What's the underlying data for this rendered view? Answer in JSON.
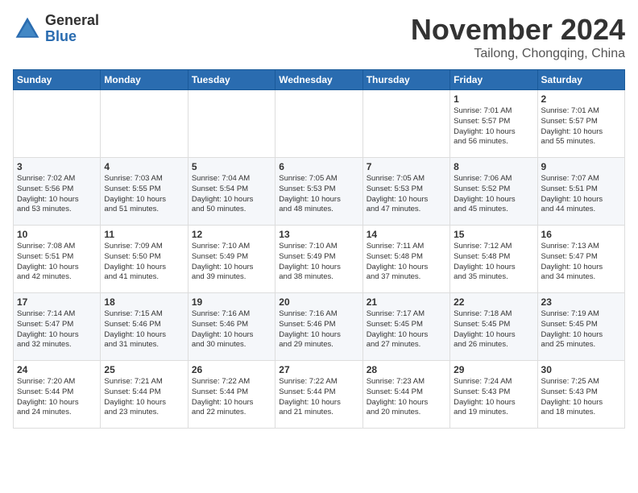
{
  "header": {
    "logo_general": "General",
    "logo_blue": "Blue",
    "title": "November 2024",
    "location": "Tailong, Chongqing, China"
  },
  "weekdays": [
    "Sunday",
    "Monday",
    "Tuesday",
    "Wednesday",
    "Thursday",
    "Friday",
    "Saturday"
  ],
  "weeks": [
    [
      {
        "day": "",
        "info": ""
      },
      {
        "day": "",
        "info": ""
      },
      {
        "day": "",
        "info": ""
      },
      {
        "day": "",
        "info": ""
      },
      {
        "day": "",
        "info": ""
      },
      {
        "day": "1",
        "info": "Sunrise: 7:01 AM\nSunset: 5:57 PM\nDaylight: 10 hours\nand 56 minutes."
      },
      {
        "day": "2",
        "info": "Sunrise: 7:01 AM\nSunset: 5:57 PM\nDaylight: 10 hours\nand 55 minutes."
      }
    ],
    [
      {
        "day": "3",
        "info": "Sunrise: 7:02 AM\nSunset: 5:56 PM\nDaylight: 10 hours\nand 53 minutes."
      },
      {
        "day": "4",
        "info": "Sunrise: 7:03 AM\nSunset: 5:55 PM\nDaylight: 10 hours\nand 51 minutes."
      },
      {
        "day": "5",
        "info": "Sunrise: 7:04 AM\nSunset: 5:54 PM\nDaylight: 10 hours\nand 50 minutes."
      },
      {
        "day": "6",
        "info": "Sunrise: 7:05 AM\nSunset: 5:53 PM\nDaylight: 10 hours\nand 48 minutes."
      },
      {
        "day": "7",
        "info": "Sunrise: 7:05 AM\nSunset: 5:53 PM\nDaylight: 10 hours\nand 47 minutes."
      },
      {
        "day": "8",
        "info": "Sunrise: 7:06 AM\nSunset: 5:52 PM\nDaylight: 10 hours\nand 45 minutes."
      },
      {
        "day": "9",
        "info": "Sunrise: 7:07 AM\nSunset: 5:51 PM\nDaylight: 10 hours\nand 44 minutes."
      }
    ],
    [
      {
        "day": "10",
        "info": "Sunrise: 7:08 AM\nSunset: 5:51 PM\nDaylight: 10 hours\nand 42 minutes."
      },
      {
        "day": "11",
        "info": "Sunrise: 7:09 AM\nSunset: 5:50 PM\nDaylight: 10 hours\nand 41 minutes."
      },
      {
        "day": "12",
        "info": "Sunrise: 7:10 AM\nSunset: 5:49 PM\nDaylight: 10 hours\nand 39 minutes."
      },
      {
        "day": "13",
        "info": "Sunrise: 7:10 AM\nSunset: 5:49 PM\nDaylight: 10 hours\nand 38 minutes."
      },
      {
        "day": "14",
        "info": "Sunrise: 7:11 AM\nSunset: 5:48 PM\nDaylight: 10 hours\nand 37 minutes."
      },
      {
        "day": "15",
        "info": "Sunrise: 7:12 AM\nSunset: 5:48 PM\nDaylight: 10 hours\nand 35 minutes."
      },
      {
        "day": "16",
        "info": "Sunrise: 7:13 AM\nSunset: 5:47 PM\nDaylight: 10 hours\nand 34 minutes."
      }
    ],
    [
      {
        "day": "17",
        "info": "Sunrise: 7:14 AM\nSunset: 5:47 PM\nDaylight: 10 hours\nand 32 minutes."
      },
      {
        "day": "18",
        "info": "Sunrise: 7:15 AM\nSunset: 5:46 PM\nDaylight: 10 hours\nand 31 minutes."
      },
      {
        "day": "19",
        "info": "Sunrise: 7:16 AM\nSunset: 5:46 PM\nDaylight: 10 hours\nand 30 minutes."
      },
      {
        "day": "20",
        "info": "Sunrise: 7:16 AM\nSunset: 5:46 PM\nDaylight: 10 hours\nand 29 minutes."
      },
      {
        "day": "21",
        "info": "Sunrise: 7:17 AM\nSunset: 5:45 PM\nDaylight: 10 hours\nand 27 minutes."
      },
      {
        "day": "22",
        "info": "Sunrise: 7:18 AM\nSunset: 5:45 PM\nDaylight: 10 hours\nand 26 minutes."
      },
      {
        "day": "23",
        "info": "Sunrise: 7:19 AM\nSunset: 5:45 PM\nDaylight: 10 hours\nand 25 minutes."
      }
    ],
    [
      {
        "day": "24",
        "info": "Sunrise: 7:20 AM\nSunset: 5:44 PM\nDaylight: 10 hours\nand 24 minutes."
      },
      {
        "day": "25",
        "info": "Sunrise: 7:21 AM\nSunset: 5:44 PM\nDaylight: 10 hours\nand 23 minutes."
      },
      {
        "day": "26",
        "info": "Sunrise: 7:22 AM\nSunset: 5:44 PM\nDaylight: 10 hours\nand 22 minutes."
      },
      {
        "day": "27",
        "info": "Sunrise: 7:22 AM\nSunset: 5:44 PM\nDaylight: 10 hours\nand 21 minutes."
      },
      {
        "day": "28",
        "info": "Sunrise: 7:23 AM\nSunset: 5:44 PM\nDaylight: 10 hours\nand 20 minutes."
      },
      {
        "day": "29",
        "info": "Sunrise: 7:24 AM\nSunset: 5:43 PM\nDaylight: 10 hours\nand 19 minutes."
      },
      {
        "day": "30",
        "info": "Sunrise: 7:25 AM\nSunset: 5:43 PM\nDaylight: 10 hours\nand 18 minutes."
      }
    ]
  ]
}
